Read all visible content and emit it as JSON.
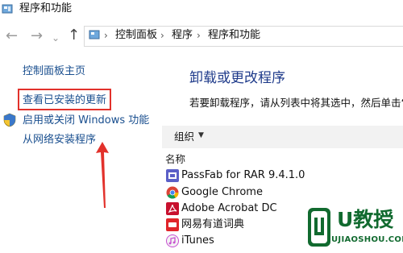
{
  "window": {
    "title": "程序和功能"
  },
  "address": {
    "crumbs": [
      "控制面板",
      "程序",
      "程序和功能"
    ]
  },
  "sidebar": {
    "home": "控制面板主页",
    "view_updates": "查看已安装的更新",
    "windows_features": "启用或关闭 Windows 功能",
    "install_from_network": "从网络安装程序"
  },
  "main": {
    "heading": "卸载或更改程序",
    "description": "若要卸载程序，请从列表中将其选中，然后单击“",
    "toolbar_organize": "组织",
    "column_name": "名称",
    "programs": [
      "PassFab for RAR 9.4.1.0",
      "Google Chrome",
      "Adobe Acrobat DC",
      "网易有道词典",
      "iTunes"
    ]
  },
  "watermark": {
    "text": "U教授",
    "url": "UJIAOSHOU.COM"
  },
  "colors": {
    "accent_link": "#1a4f8f",
    "heading": "#1e3a8a",
    "annotation": "#e2312b",
    "watermark": "#116a2f"
  },
  "icons": [
    "control-panel-icon",
    "back-arrow-icon",
    "forward-arrow-icon",
    "chevron-down-icon",
    "up-arrow-icon",
    "shield-icon",
    "passfab-icon",
    "chrome-icon",
    "acrobat-icon",
    "youdao-icon",
    "itunes-icon"
  ]
}
